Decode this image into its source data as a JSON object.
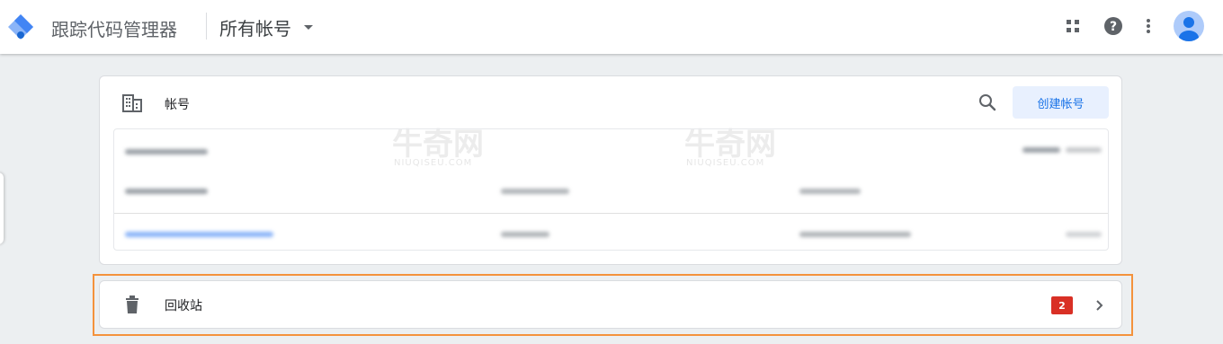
{
  "header": {
    "app_title": "跟踪代码管理器",
    "account_selector_label": "所有帐号",
    "icons": [
      "tag-manager-logo-icon",
      "apps-grid-icon",
      "help-icon",
      "more-vert-icon",
      "avatar"
    ]
  },
  "accounts_card": {
    "title": "帐号",
    "create_button_label": "创建帐号",
    "icons": [
      "building-icon",
      "search-icon"
    ]
  },
  "watermark": {
    "text": "牛奇网",
    "sub": "NIUQISEU.COM"
  },
  "trash": {
    "label": "回收站",
    "count": "2",
    "icons": [
      "trash-icon",
      "chevron-right-icon"
    ]
  },
  "colors": {
    "accent": "#1a73e8",
    "badge": "#d93025",
    "highlight": "#f4923c"
  }
}
